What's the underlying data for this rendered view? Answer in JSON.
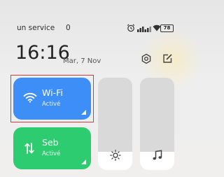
{
  "status_bar": {
    "carrier": "un service",
    "indicator": "0",
    "battery": "78",
    "icons": [
      "alarm-icon",
      "signal-icon",
      "wifi-icon"
    ]
  },
  "clock": {
    "time": "16:16",
    "date": "Mar, 7 Nov"
  },
  "header_icons": [
    "settings-icon",
    "edit-icon"
  ],
  "tiles": [
    {
      "title": "Wi-Fi",
      "subtitle": "Activé",
      "icon": "wifi-icon",
      "color": "#3d8ef7",
      "highlighted": true
    },
    {
      "title": "Seb",
      "subtitle": "Activé",
      "icon": "mobile-data-icon",
      "color": "#2ecc71"
    }
  ],
  "sliders": {
    "brightness": {
      "level": 0.2,
      "icon": "sun-icon"
    },
    "volume": {
      "level": 0.2,
      "icon": "music-note-icon"
    }
  },
  "colors": {
    "highlight": "#d93b3b",
    "slider_track": "#d9d9d9",
    "slider_fill": "#ffffff"
  }
}
